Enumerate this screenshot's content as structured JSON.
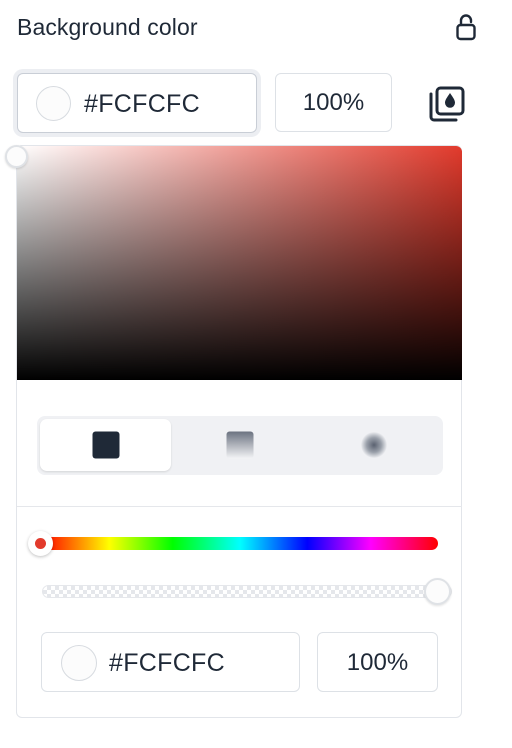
{
  "header": {
    "title": "Background color",
    "lock_icon": "lock-open-icon"
  },
  "color": {
    "hex": "#FCFCFC",
    "opacity": "100%",
    "swatch_color": "#fcfcfc",
    "library_icon": "color-library-icon"
  },
  "picker": {
    "modes": [
      {
        "name": "solid",
        "icon": "solid-fill-icon",
        "active": true
      },
      {
        "name": "linear",
        "icon": "linear-gradient-icon",
        "active": false
      },
      {
        "name": "radial",
        "icon": "radial-gradient-icon",
        "active": false
      }
    ],
    "hue_color": "#e23a2c",
    "hue_fraction": 0,
    "alpha_fraction": 1,
    "hex": "#FCFCFC",
    "opacity": "100%"
  }
}
